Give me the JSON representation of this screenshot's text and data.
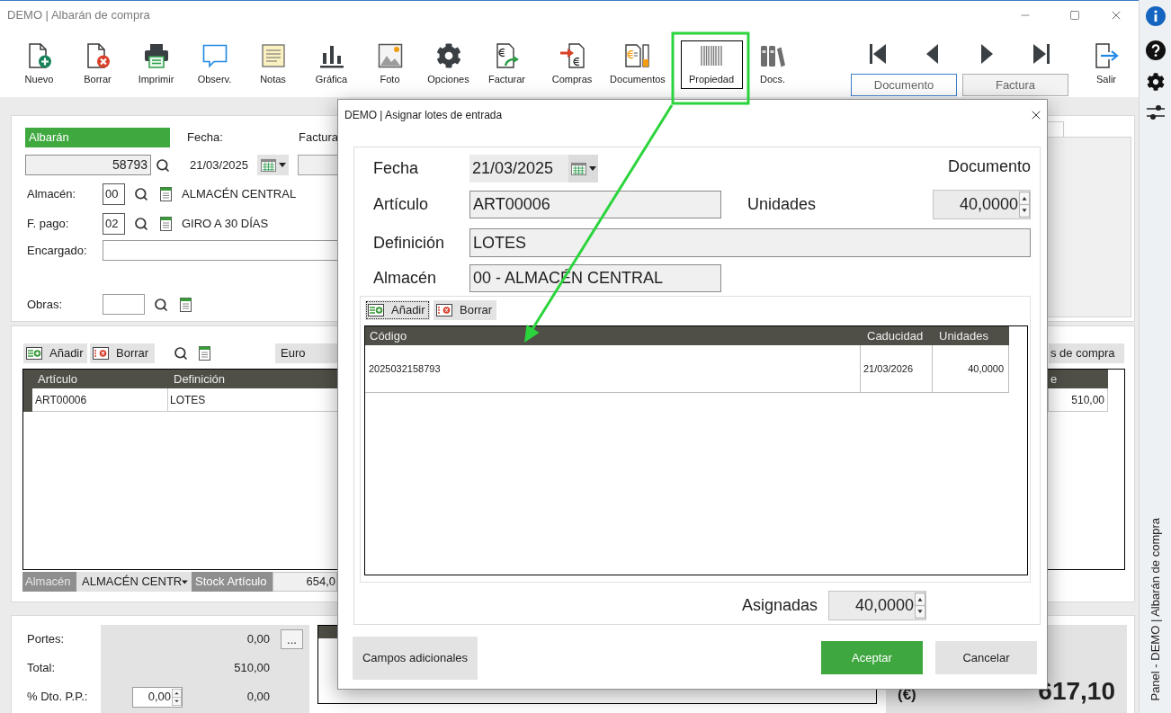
{
  "window": {
    "title": "DEMO | Albarán de compra"
  },
  "toolbar": [
    {
      "kind": "new",
      "label": "Nuevo",
      "focused": false
    },
    {
      "kind": "delete",
      "label": "Borrar",
      "focused": false
    },
    {
      "kind": "print",
      "label": "Imprimir",
      "focused": false
    },
    {
      "kind": "comment",
      "label": "Observ.",
      "focused": false
    },
    {
      "kind": "notes",
      "label": "Notas",
      "focused": false
    },
    {
      "kind": "chart",
      "label": "Gráfica",
      "focused": false
    },
    {
      "kind": "photo",
      "label": "Foto",
      "focused": false
    },
    {
      "kind": "settings",
      "label": "Opciones",
      "focused": false
    },
    {
      "kind": "invoice",
      "label": "Facturar",
      "focused": false
    },
    {
      "kind": "purchases",
      "label": "Compras",
      "focused": false
    },
    {
      "kind": "documents",
      "label": "Documentos",
      "focused": false
    },
    {
      "kind": "barcode",
      "label": "Propiedad",
      "focused": true
    },
    {
      "kind": "books",
      "label": "Docs.",
      "focused": false
    }
  ],
  "navigation": {
    "arrows": [
      {
        "kind": "first"
      },
      {
        "kind": "previous"
      },
      {
        "kind": "next"
      },
      {
        "kind": "last"
      }
    ],
    "tabs": [
      {
        "label": "Documento",
        "selected": true
      },
      {
        "label": "Factura",
        "selected": false
      }
    ]
  },
  "exit": {
    "label": "Salir"
  },
  "side_panel": {
    "caption": "Panel - DEMO | Albarán de compra"
  },
  "header": {
    "section": "Albarán",
    "number": "58793",
    "date_label": "Fecha:",
    "date": "21/03/2025",
    "invoice_label": "Factura",
    "lookups": [
      {
        "label": "Almacén:",
        "code": "00",
        "name": "ALMACÉN CENTRAL"
      },
      {
        "label": "F. pago:",
        "code": "02",
        "name": "GIRO A 30 DÍAS"
      }
    ],
    "manager_label": "Encargado:",
    "works_label": "Obras:"
  },
  "lines": {
    "actions": [
      {
        "kind": "add",
        "label": "Añadir"
      },
      {
        "kind": "remove",
        "label": "Borrar"
      }
    ],
    "currency": "Euro",
    "side_button": "s de compra",
    "columns": [
      "Artículo",
      "Definición"
    ],
    "column_3": "e",
    "rows": [
      {
        "article": "ART00006",
        "definition": "LOTES",
        "column_3": "510,00"
      }
    ],
    "footer": {
      "warehouse_label": "Almacén",
      "warehouse": "ALMACÉN CENTR",
      "stock_label": "Stock Artículo",
      "stock": "654,0"
    }
  },
  "totals": {
    "freight": {
      "label": "Portes:",
      "value": "0,00",
      "button": "..."
    },
    "total": {
      "label": "Total:",
      "value": "510,00"
    },
    "discount": {
      "label": "% Dto. P.P.:",
      "input": "0,00",
      "value": "0,00"
    },
    "currency_label": "(€)",
    "grand_total": "617,10"
  },
  "dialog": {
    "title": "DEMO | Asignar lotes de entrada",
    "date_label": "Fecha",
    "date": "21/03/2025",
    "document_label": "Documento",
    "article": {
      "label": "Artículo",
      "value": "ART00006"
    },
    "units": {
      "label": "Unidades",
      "value": "40,0000"
    },
    "definition": {
      "label": "Definición",
      "value": "LOTES"
    },
    "warehouse": {
      "label": "Almacén",
      "value": "00 - ALMACÉN CENTRAL"
    },
    "actions": [
      {
        "kind": "add",
        "label": "Añadir",
        "focused": true
      },
      {
        "kind": "remove",
        "label": "Borrar",
        "focused": false
      }
    ],
    "grid": {
      "columns": [
        "Código",
        "Caducidad",
        "Unidades"
      ],
      "rows": [
        [
          "2025032158793",
          "21/03/2026",
          "40,0000"
        ]
      ]
    },
    "assigned": {
      "label": "Asignadas",
      "value": "40,0000"
    },
    "buttons": [
      {
        "kind": "secondary",
        "label": "Campos adicionales"
      },
      {
        "kind": "primary",
        "label": "Aceptar"
      },
      {
        "kind": "secondary",
        "label": "Cancelar"
      }
    ]
  }
}
